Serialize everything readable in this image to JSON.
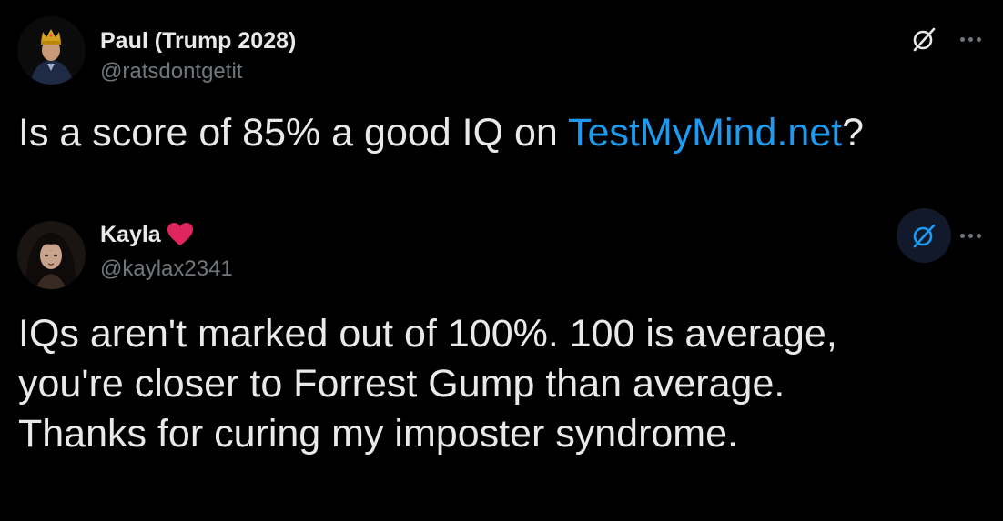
{
  "tweets": [
    {
      "author": {
        "display_name": "Paul (Trump 2028)",
        "handle": "@ratsdontgetit",
        "avatar": "man-with-gold-crown-avatar"
      },
      "text_before_link": "Is a score of 85% a good IQ on ",
      "link_text": "TestMyMind.net",
      "text_after_link": "?",
      "icons": [
        "grok-icon",
        "more-icon"
      ]
    },
    {
      "author": {
        "display_name": "Kayla",
        "name_badge": "red-heart-icon",
        "handle": "@kaylax2341",
        "avatar": "dark-haired-woman-avatar"
      },
      "text_lines": [
        "IQs aren't marked out of 100%. 100 is average,",
        "you're closer to Forrest Gump than average.",
        "Thanks for curing my imposter syndrome."
      ],
      "icons": [
        "grok-icon",
        "more-icon"
      ]
    }
  ],
  "colors": {
    "background": "#000000",
    "text_primary": "#e7e9ea",
    "text_secondary": "#71767b",
    "link": "#1d9bf0",
    "heart": "#f91880",
    "grok_hover_bg": "#11192b"
  }
}
